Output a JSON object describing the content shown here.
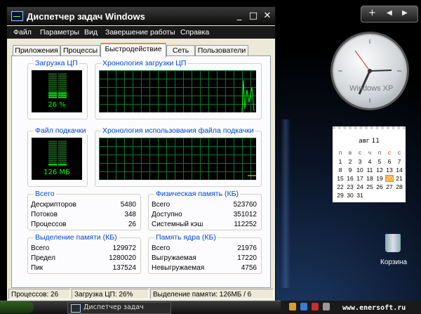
{
  "window": {
    "title": "Диспетчер задач Windows",
    "controls": {
      "minimize": "_",
      "maximize": "□",
      "close": "✕"
    }
  },
  "menu": [
    "Файл",
    "Параметры",
    "Вид",
    "Завершение работы",
    "Справка"
  ],
  "tabs": [
    "Приложения",
    "Процессы",
    "Быстродействие",
    "Сеть",
    "Пользователи"
  ],
  "active_tab": "Быстродействие",
  "performance": {
    "cpu_usage": {
      "title": "Загрузка ЦП",
      "value": "26 %",
      "level": 0.26
    },
    "cpu_history": {
      "title": "Хронология загрузки ЦП",
      "latest": 0.26
    },
    "pagefile": {
      "title": "Файл подкачки",
      "value": "126 МБ",
      "level": 0.1
    },
    "pagefile_history": {
      "title": "Хронология использования файла подкачки"
    },
    "totals": {
      "title": "Всего",
      "rows": [
        {
          "label": "Дескрипторов",
          "value": "5480"
        },
        {
          "label": "Потоков",
          "value": "348"
        },
        {
          "label": "Процессов",
          "value": "26"
        }
      ]
    },
    "physical_memory": {
      "title": "Физическая память (КБ)",
      "rows": [
        {
          "label": "Всего",
          "value": "523760"
        },
        {
          "label": "Доступно",
          "value": "351012"
        },
        {
          "label": "Системный кэш",
          "value": "112252"
        }
      ]
    },
    "commit_charge": {
      "title": "Выделение памяти (КБ)",
      "rows": [
        {
          "label": "Всего",
          "value": "129972"
        },
        {
          "label": "Предел",
          "value": "1280020"
        },
        {
          "label": "Пик",
          "value": "137524"
        }
      ]
    },
    "kernel_memory": {
      "title": "Память ядра (КБ)",
      "rows": [
        {
          "label": "Всего",
          "value": "21976"
        },
        {
          "label": "Выгружаемая",
          "value": "17220"
        },
        {
          "label": "Невыгружаемая",
          "value": "4756"
        }
      ]
    }
  },
  "status_bar": {
    "processes": "Процессов: 26",
    "cpu": "Загрузка ЦП: 26%",
    "commit": "Выделение памяти: 126МБ / 6"
  },
  "sidebar": {
    "controls": {
      "add": "+",
      "prev": "◀",
      "next": "▶"
    },
    "clock_label": "Windows XP",
    "calendar": {
      "month": "авг 11",
      "weekdays": [
        "п",
        "в",
        "с",
        "ч",
        "п",
        "с",
        "с"
      ],
      "weeks": [
        [
          "1",
          "2",
          "3",
          "4",
          "5",
          "6",
          "7"
        ],
        [
          "8",
          "9",
          "10",
          "11",
          "12",
          "13",
          "14"
        ],
        [
          "15",
          "16",
          "17",
          "18",
          "19",
          "20",
          "21"
        ],
        [
          "22",
          "23",
          "24",
          "25",
          "26",
          "27",
          "28"
        ],
        [
          "29",
          "30",
          "31",
          "",
          "",
          "",
          ""
        ]
      ],
      "today": "20"
    },
    "recycle_bin_label": "Корзина"
  },
  "taskbar": {
    "task_label": "Диспетчер задач",
    "watermark": "www.enersoft.ru"
  },
  "colors": {
    "graph_line": "#00ff00",
    "graph_grid": "#0a7a2e",
    "group_title": "#0046d5",
    "active_tab_accent": "#e68b2c",
    "today": "#f39c21"
  }
}
